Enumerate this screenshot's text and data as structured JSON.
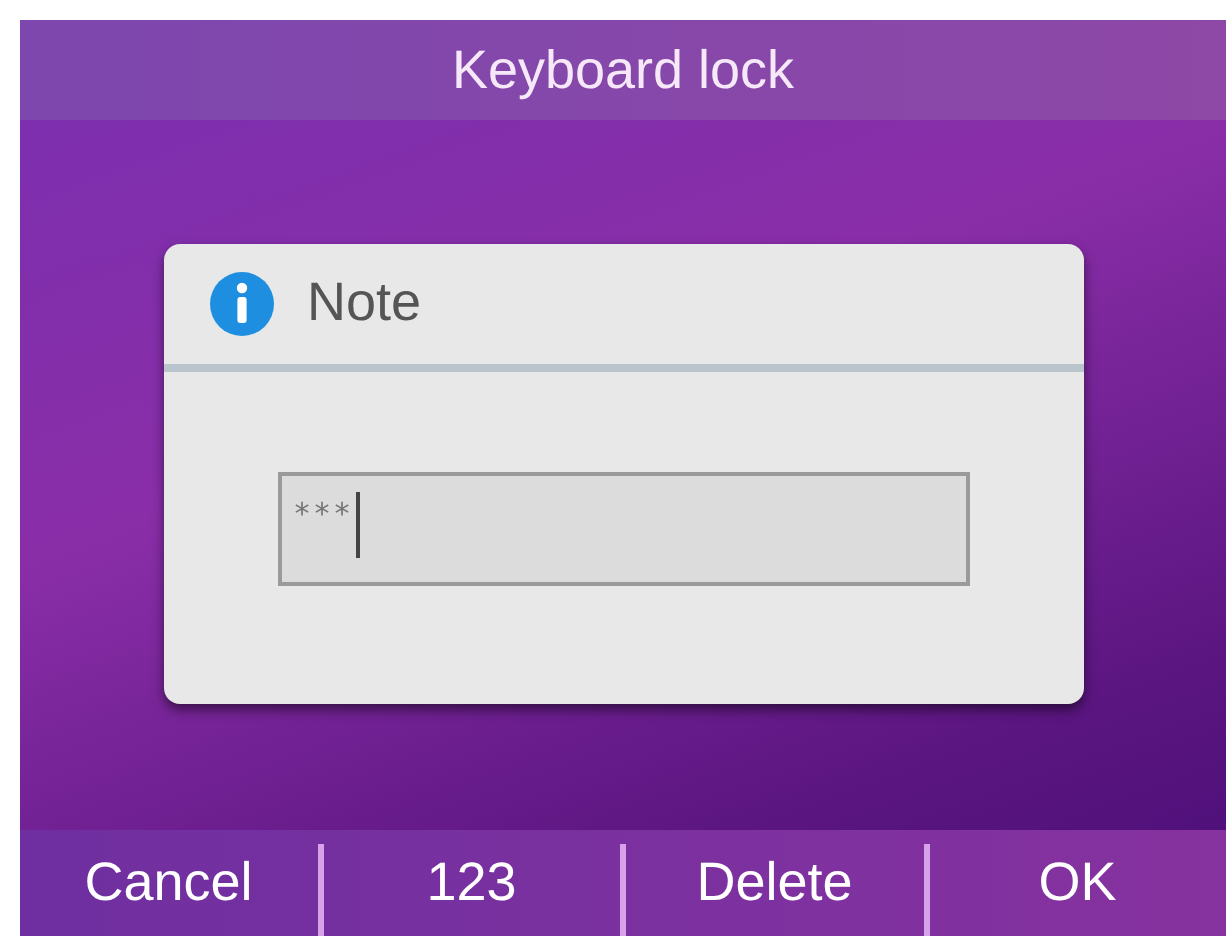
{
  "title_bar": {
    "title": "Keyboard lock"
  },
  "dialog": {
    "title": "Note",
    "field": {
      "value": "***",
      "focused": true
    }
  },
  "softkeys": [
    {
      "label": "Cancel"
    },
    {
      "label": "123"
    },
    {
      "label": "Delete"
    },
    {
      "label": "OK"
    }
  ]
}
